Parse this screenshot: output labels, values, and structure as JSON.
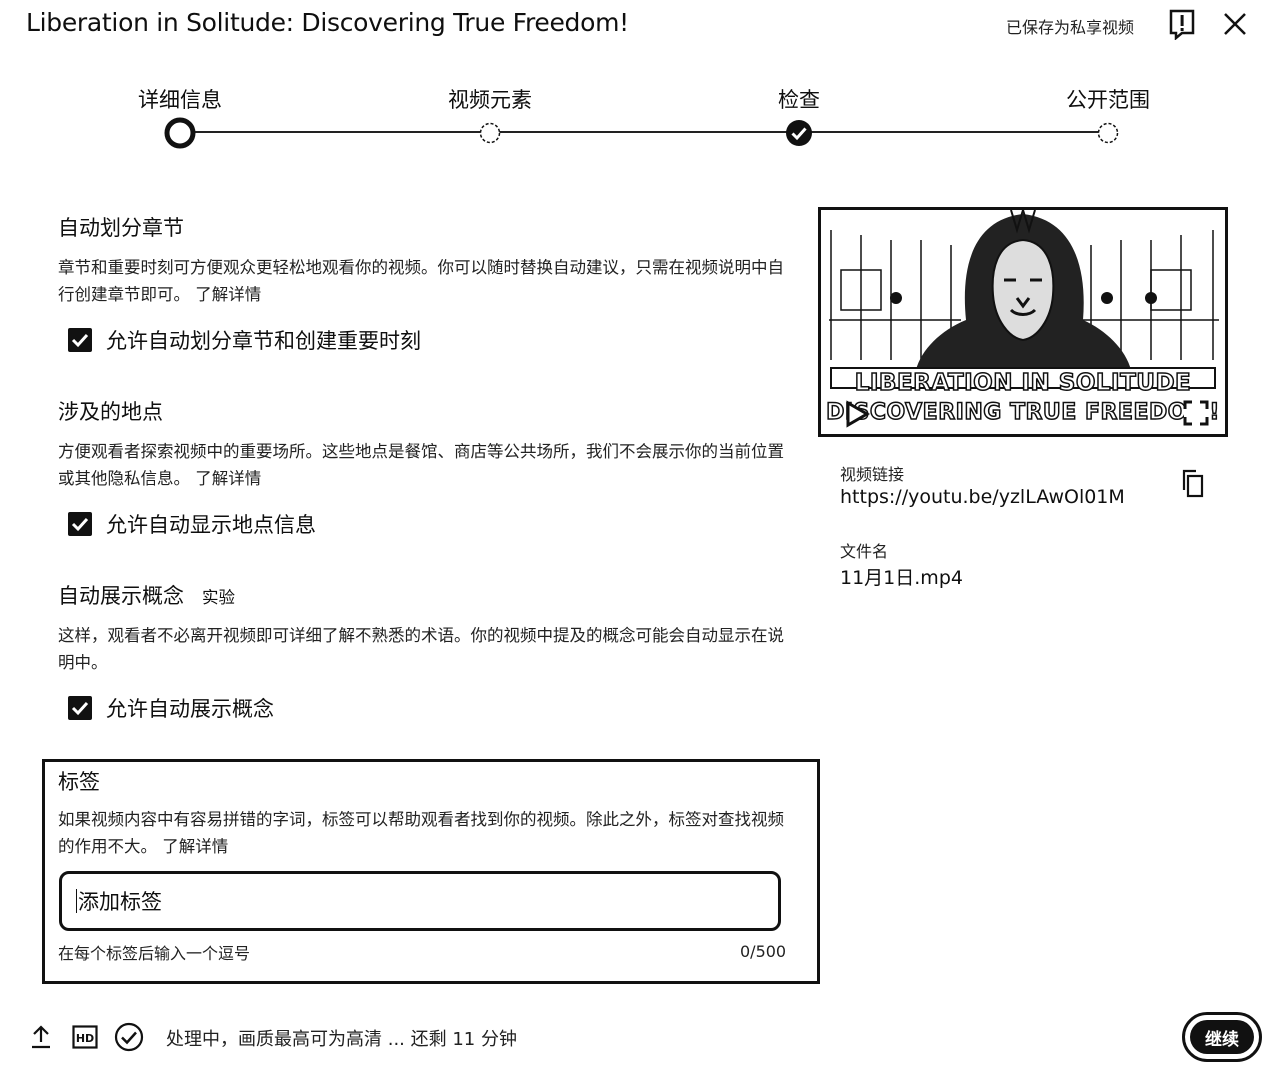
{
  "header": {
    "title": "Liberation in Solitude: Discovering True Freedom!",
    "saved_status": "已保存为私享视频"
  },
  "stepper": {
    "steps": [
      {
        "label": "详细信息",
        "state": "current"
      },
      {
        "label": "视频元素",
        "state": "pending"
      },
      {
        "label": "检查",
        "state": "done"
      },
      {
        "label": "公开范围",
        "state": "pending"
      }
    ]
  },
  "chapters": {
    "title": "自动划分章节",
    "description": "章节和重要时刻可方便观众更轻松地观看你的视频。你可以随时替换自动建议，只需在视频说明中自行创建章节即可。",
    "link": "了解详情",
    "checkbox_label": "允许自动划分章节和创建重要时刻",
    "checked": true
  },
  "places": {
    "title": "涉及的地点",
    "description": "方便观看者探索视频中的重要场所。这些地点是餐馆、商店等公共场所，我们不会展示你的当前位置或其他隐私信息。",
    "link": "了解详情",
    "checkbox_label": "允许自动显示地点信息",
    "checked": true
  },
  "concepts": {
    "title": "自动展示概念",
    "badge": "实验",
    "description": "这样，观看者不必离开视频即可详细了解不熟悉的术语。你的视频中提及的概念可能会自动显示在说明中。",
    "checkbox_label": "允许自动展示概念",
    "checked": true
  },
  "tags": {
    "title": "标签",
    "description": "如果视频内容中有容易拼错的字词，标签可以帮助观看者找到你的视频。除此之外，标签对查找视频的作用不大。",
    "link": "了解详情",
    "placeholder": "添加标签",
    "hint": "在每个标签后输入一个逗号",
    "count": "0/500"
  },
  "video": {
    "thumbnail_line1": "LIBERATION IN SOLITUDE",
    "thumbnail_line2": "DISCOVERING TRUE FREEDOM!",
    "link_label": "视频链接",
    "link_value": "https://youtu.be/yzlLAwOl01M",
    "filename_label": "文件名",
    "filename_value": "11月1日.mp4"
  },
  "footer": {
    "status": "处理中，画质最高可为高清 ... 还剩 11 分钟",
    "continue_label": "继续"
  }
}
